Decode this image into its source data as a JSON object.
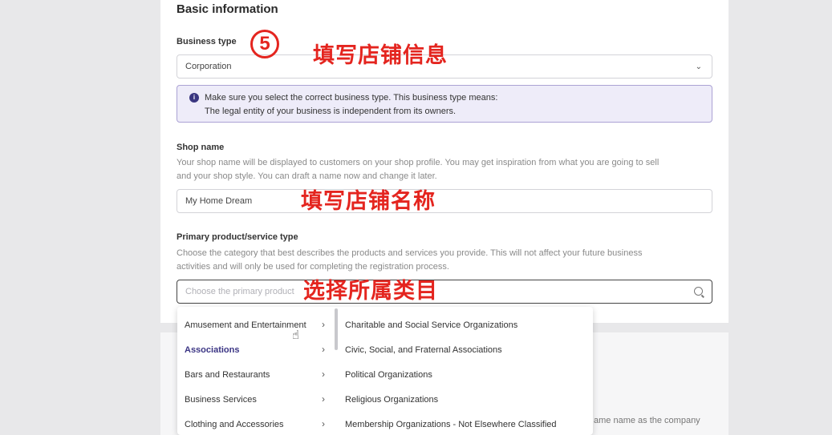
{
  "section": {
    "title": "Basic information"
  },
  "business_type": {
    "label": "Business type",
    "value": "Corporation",
    "notice_line1": "Make sure you select the correct business type. This business type means:",
    "notice_line2": "The legal entity of your business is independent from its owners."
  },
  "shop_name": {
    "label": "Shop name",
    "help_line1": "Your shop name will be displayed to customers on your shop profile. You may get inspiration from what you are going to sell",
    "help_line2": "and your shop style. You can draft a name now and change it later.",
    "value": "My Home Dream"
  },
  "primary_product": {
    "label": "Primary product/service type",
    "help_line1": "Choose the category that best describes the products and services you provide. This will not affect your future business",
    "help_line2": "activities and will only be used for completing the registration process.",
    "placeholder": "Choose the primary product"
  },
  "dropdown": {
    "categories": [
      "Amusement and Entertainment",
      "Associations",
      "Bars and Restaurants",
      "Business Services",
      "Clothing and Accessories"
    ],
    "subcategories": [
      "Charitable and Social Service Organizations",
      "Civic, Social, and Fraternal Associations",
      "Political Organizations",
      "Religious Organizations",
      "Membership Organizations - Not Elsewhere Classified"
    ],
    "arrow": "›",
    "active_index": 1
  },
  "annotations": {
    "step_number": "5",
    "step_text": "填写店铺信息",
    "shop_name_text": "填写店铺名称",
    "category_text": "选择所属类目"
  },
  "behind_text": "ame name as the company",
  "icons": {
    "chevron": "chevron-down-icon",
    "search": "search-icon",
    "info": "info-icon",
    "cursor": "hand-cursor-icon"
  },
  "colors": {
    "accent": "#3b3584",
    "annotation": "#e4251f",
    "notice_bg": "#eeecf9"
  }
}
